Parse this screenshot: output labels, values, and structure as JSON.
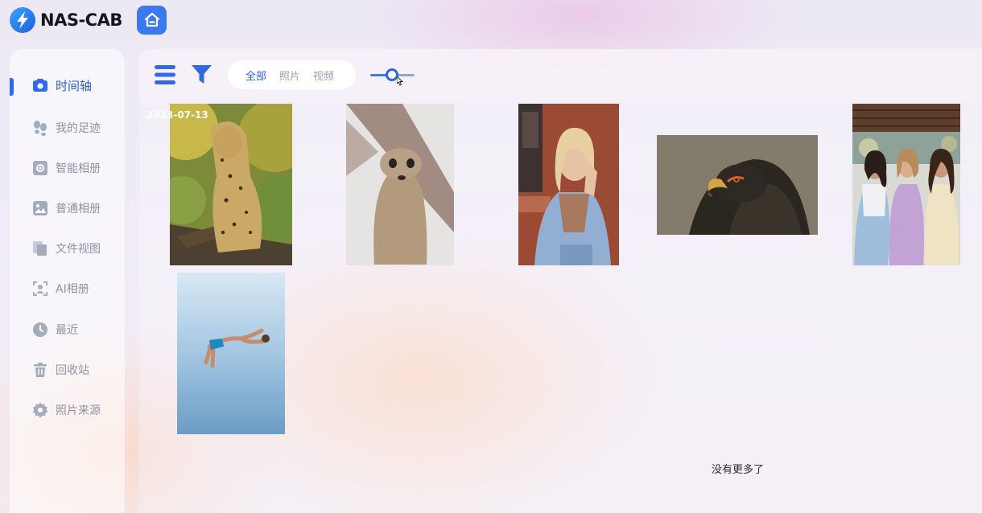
{
  "app": {
    "name": "NAS-CAB"
  },
  "sidebar": {
    "items": [
      {
        "label": "时间轴",
        "icon": "camera-icon",
        "active": true
      },
      {
        "label": "我的足迹",
        "icon": "footprints-icon",
        "active": false
      },
      {
        "label": "智能相册",
        "icon": "smart-album-icon",
        "active": false
      },
      {
        "label": "普通相册",
        "icon": "image-icon",
        "active": false
      },
      {
        "label": "文件视图",
        "icon": "files-icon",
        "active": false
      },
      {
        "label": "AI相册",
        "icon": "ai-face-icon",
        "active": false
      },
      {
        "label": "最近",
        "icon": "clock-icon",
        "active": false
      },
      {
        "label": "回收站",
        "icon": "trash-icon",
        "active": false
      },
      {
        "label": "照片来源",
        "icon": "gear-icon",
        "active": false
      }
    ]
  },
  "toolbar": {
    "filter_tabs": [
      {
        "label": "全部",
        "selected": true
      },
      {
        "label": "照片",
        "selected": false
      },
      {
        "label": "视频",
        "selected": false
      }
    ]
  },
  "timeline": {
    "date": "2023-07-13",
    "photos": [
      {
        "name": "leopard-in-tree"
      },
      {
        "name": "meerkat"
      },
      {
        "name": "woman-denim-jacket"
      },
      {
        "name": "eagle-head"
      },
      {
        "name": "three-women-smiling"
      },
      {
        "name": "backflip-jump"
      }
    ],
    "end_text": "没有更多了"
  },
  "colors": {
    "accent": "#2f6af0",
    "sidebar_text": "#8b93a4"
  }
}
